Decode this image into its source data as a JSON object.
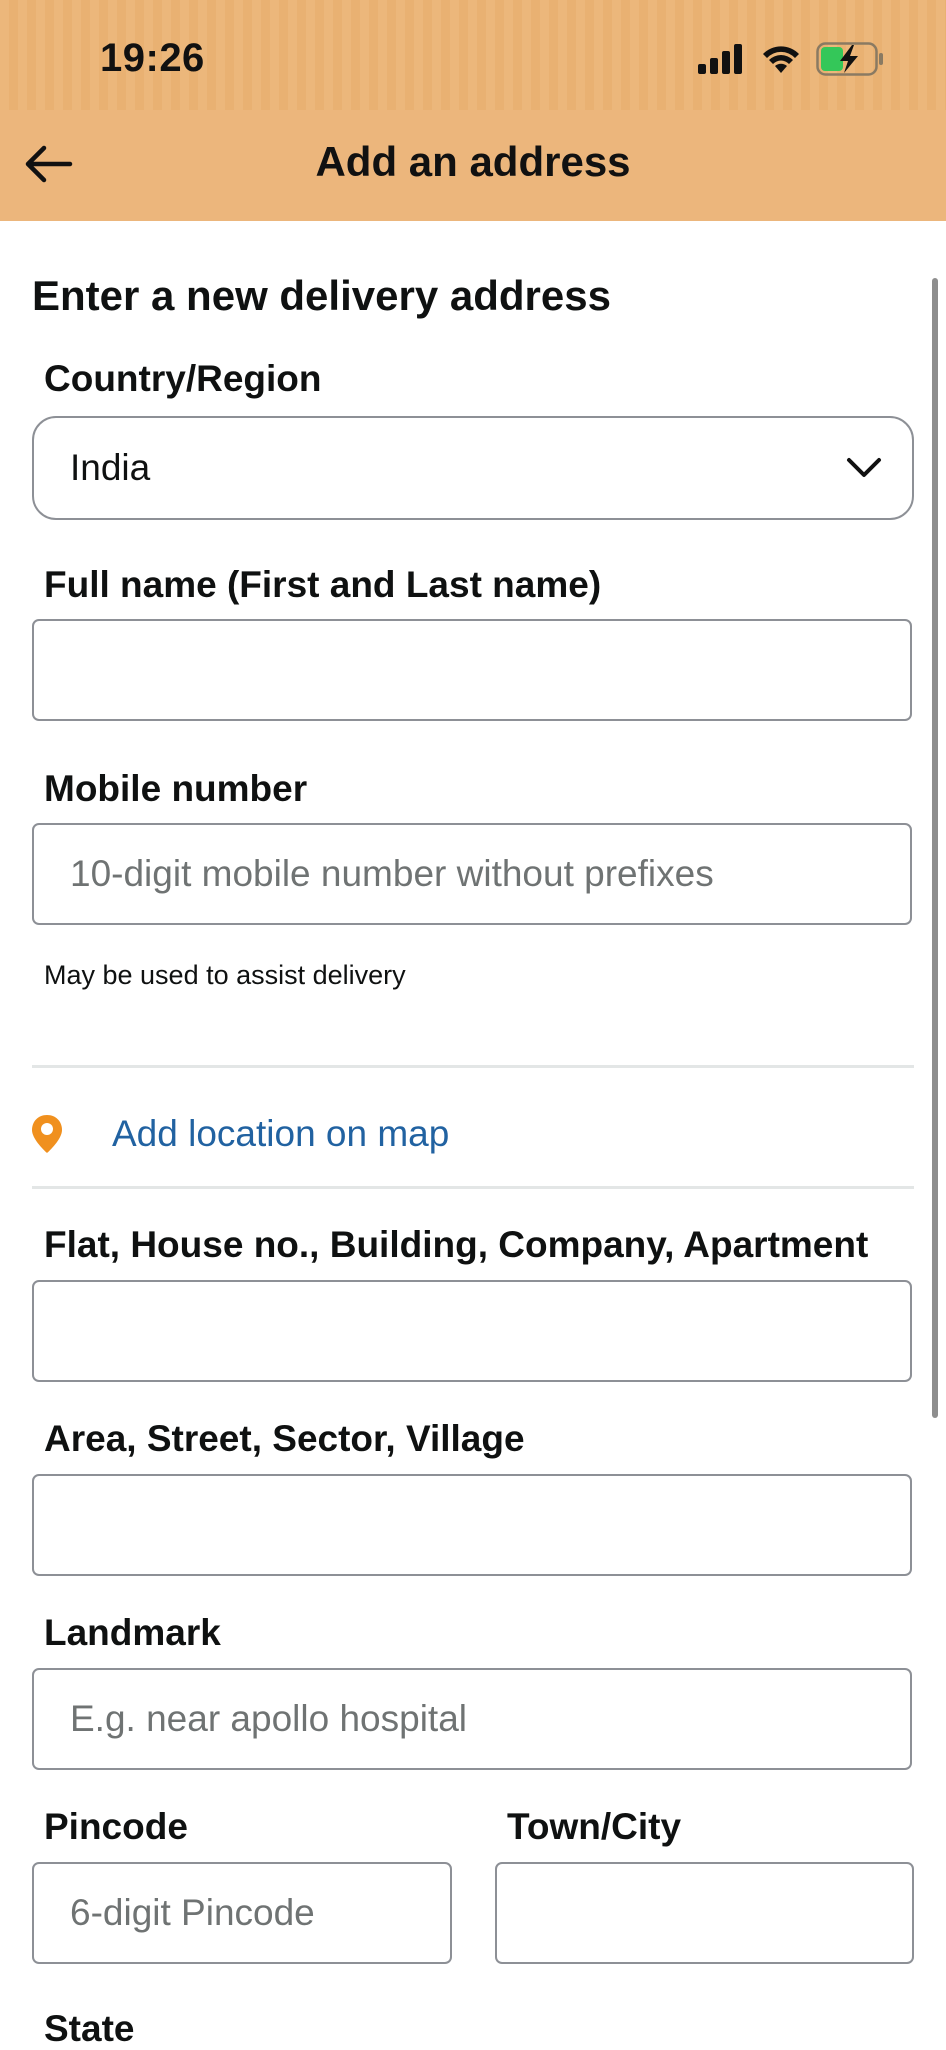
{
  "status_bar": {
    "time": "19:26"
  },
  "header": {
    "title": "Add an address"
  },
  "form": {
    "section_title": "Enter a new delivery address",
    "country": {
      "label": "Country/Region",
      "value": "India"
    },
    "full_name": {
      "label": "Full name (First and Last name)",
      "value": "",
      "placeholder": ""
    },
    "mobile": {
      "label": "Mobile number",
      "placeholder": "10-digit mobile number without prefixes",
      "hint": "May be used to assist delivery"
    },
    "map_link": {
      "label": "Add location on map"
    },
    "flat": {
      "label": "Flat, House no., Building, Company, Apartment",
      "placeholder": ""
    },
    "area": {
      "label": "Area, Street, Sector, Village",
      "placeholder": ""
    },
    "landmark": {
      "label": "Landmark",
      "placeholder": "E.g. near apollo hospital"
    },
    "pincode": {
      "label": "Pincode",
      "placeholder": "6-digit Pincode"
    },
    "city": {
      "label": "Town/City",
      "placeholder": ""
    },
    "state": {
      "label": "State"
    }
  },
  "colors": {
    "header_bg": "#ecb67c",
    "link": "#2162a1",
    "pin_icon": "#f0901e",
    "battery": "#34c759"
  },
  "icons": [
    "signal-icon",
    "wifi-icon",
    "battery-charging-icon",
    "back-arrow-icon",
    "chevron-down-icon",
    "location-pin-icon"
  ]
}
